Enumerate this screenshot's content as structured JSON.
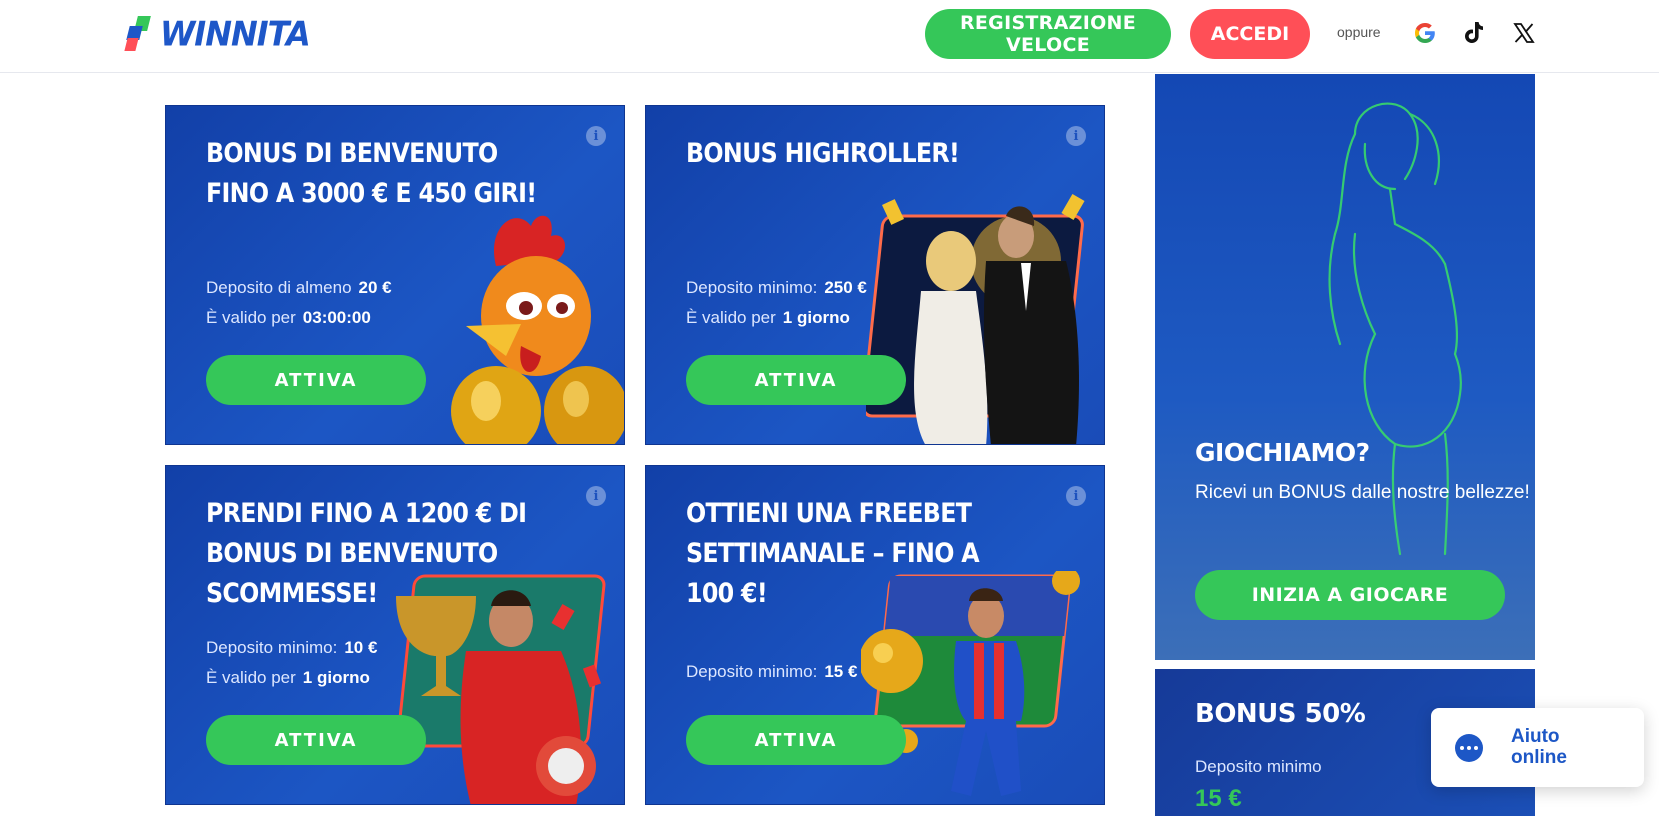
{
  "header": {
    "logo_text": "WINNITA",
    "register_label": "REGISTRAZIONE VELOCE",
    "login_label": "ACCEDI",
    "or_label": "oppure",
    "socials": [
      "google-icon",
      "tiktok-icon",
      "x-icon"
    ]
  },
  "cards": [
    {
      "title": "BONUS DI BENVENUTO FINO A 3000 € E 450 GIRI!",
      "rows": [
        {
          "label": "Deposito di almeno",
          "value": "20 €"
        },
        {
          "label": "È valido per",
          "value": "03:00:00"
        }
      ],
      "cta": "ATTIVA",
      "art": "rooster-eggs"
    },
    {
      "title": "BONUS HIGHROLLER!",
      "rows": [
        {
          "label": "Deposito minimo:",
          "value": "250 €"
        },
        {
          "label": "È valido per",
          "value": "1 giorno"
        }
      ],
      "cta": "ATTIVA",
      "art": "couple"
    },
    {
      "title": "PRENDI FINO A 1200 € DI BONUS DI BENVENUTO SCOMMESSE!",
      "rows": [
        {
          "label": "Deposito minimo:",
          "value": "10 €"
        },
        {
          "label": "È valido per",
          "value": "1 giorno"
        }
      ],
      "cta": "ATTIVA",
      "art": "racer-trophy"
    },
    {
      "title": "OTTIENI UNA FREEBET SETTIMANALE – FINO A 100 €!",
      "rows": [
        {
          "label": "Deposito minimo:",
          "value": "15 €"
        }
      ],
      "cta": "ATTIVA",
      "art": "football-player"
    }
  ],
  "side_promo": {
    "title": "GIOCHIAMO?",
    "subtitle": "Ricevi un BONUS dalle nostre bellezze!",
    "cta": "INIZIA A GIOCARE"
  },
  "side_bonus": {
    "title": "BONUS 50%",
    "label": "Deposito minimo",
    "value": "15 €"
  },
  "chat": {
    "label": "Aiuto online"
  },
  "colors": {
    "brand_blue": "#1e57c8",
    "green": "#35c759",
    "red": "#ff4f57"
  }
}
